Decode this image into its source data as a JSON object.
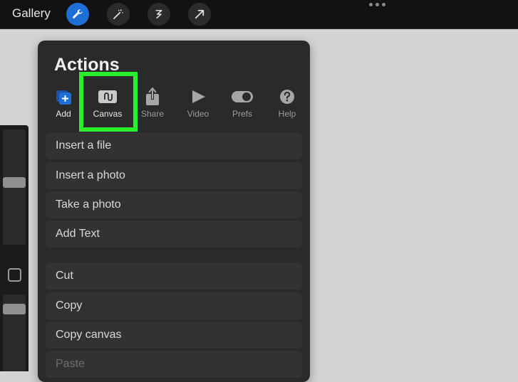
{
  "topbar": {
    "gallery_label": "Gallery",
    "tools": [
      {
        "icon": "wrench-icon",
        "active": true
      },
      {
        "icon": "magic-wand-icon",
        "active": false
      },
      {
        "icon": "selection-icon",
        "active": false
      },
      {
        "icon": "transform-arrow-icon",
        "active": false
      }
    ],
    "accent_color": "#1d6fd6"
  },
  "actions_panel": {
    "title": "Actions",
    "tabs": [
      {
        "label": "Add",
        "icon": "add-icon",
        "state": "selected"
      },
      {
        "label": "Canvas",
        "icon": "canvas-icon",
        "state": "highlighted"
      },
      {
        "label": "Share",
        "icon": "share-icon",
        "state": "normal"
      },
      {
        "label": "Video",
        "icon": "play-icon",
        "state": "normal"
      },
      {
        "label": "Prefs",
        "icon": "toggle-icon",
        "state": "normal"
      },
      {
        "label": "Help",
        "icon": "question-icon",
        "state": "normal"
      }
    ],
    "items_group1": [
      "Insert a file",
      "Insert a photo",
      "Take a photo",
      "Add Text"
    ],
    "items_group2": [
      "Cut",
      "Copy",
      "Copy canvas",
      "Paste"
    ],
    "highlight_color": "#2bef2b"
  }
}
